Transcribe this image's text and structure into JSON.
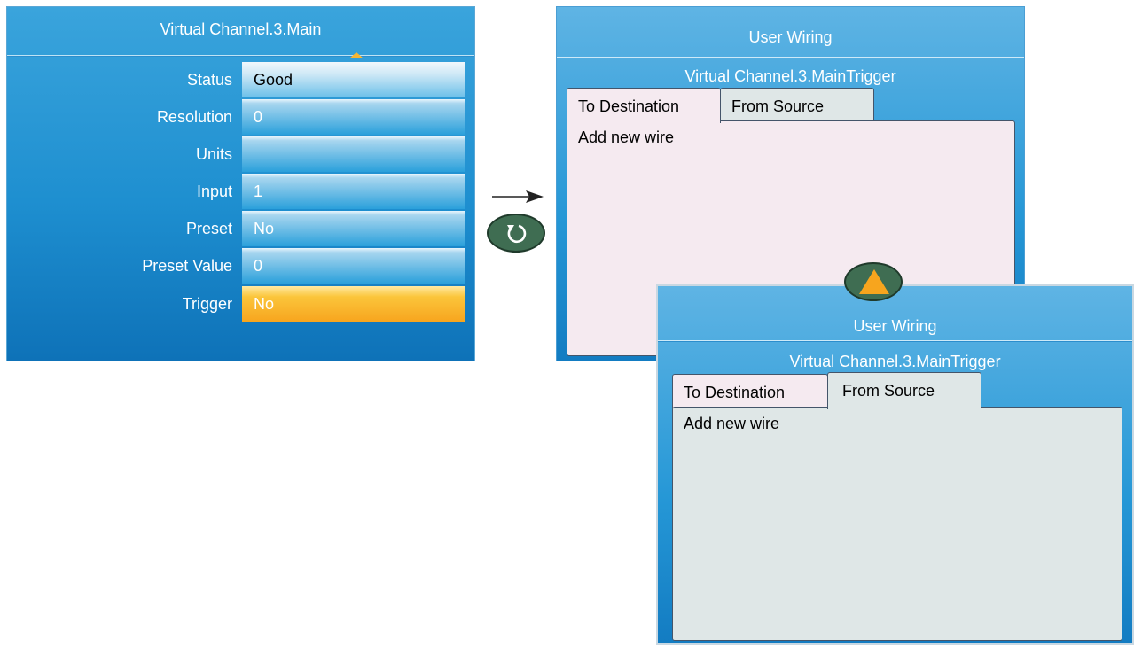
{
  "main_panel": {
    "title": "Virtual Channel.3.Main",
    "rows": [
      {
        "label": "Status",
        "value": "Good"
      },
      {
        "label": "Resolution",
        "value": "0"
      },
      {
        "label": "Units",
        "value": ""
      },
      {
        "label": "Input",
        "value": "1"
      },
      {
        "label": "Preset",
        "value": "No"
      },
      {
        "label": "Preset Value",
        "value": "0"
      },
      {
        "label": "Trigger",
        "value": "No"
      }
    ],
    "selected_row": "Trigger",
    "accent_color": "#f7a51e"
  },
  "wiring_before": {
    "title": "User Wiring",
    "subtitle": "Virtual Channel.3.MainTrigger",
    "tabs": [
      "To Destination",
      "From Source"
    ],
    "active_tab": "To Destination",
    "items": [
      "Add new wire"
    ]
  },
  "wiring_after": {
    "title": "User Wiring",
    "subtitle": "Virtual Channel.3.MainTrigger",
    "tabs": [
      "To Destination",
      "From Source"
    ],
    "active_tab": "From Source",
    "items": [
      "Add new wire"
    ]
  },
  "controls": {
    "arrow_icon": "right-arrow-icon",
    "refresh_icon": "refresh-icon",
    "scroll_icon": "triangle-up-icon"
  },
  "colors": {
    "panel_blue": "#1e8fd0",
    "tab_pink": "#f5eaf0",
    "tab_grey": "#dfe7e7",
    "button_green": "#3f6d52",
    "highlight_orange": "#f7a51e"
  }
}
